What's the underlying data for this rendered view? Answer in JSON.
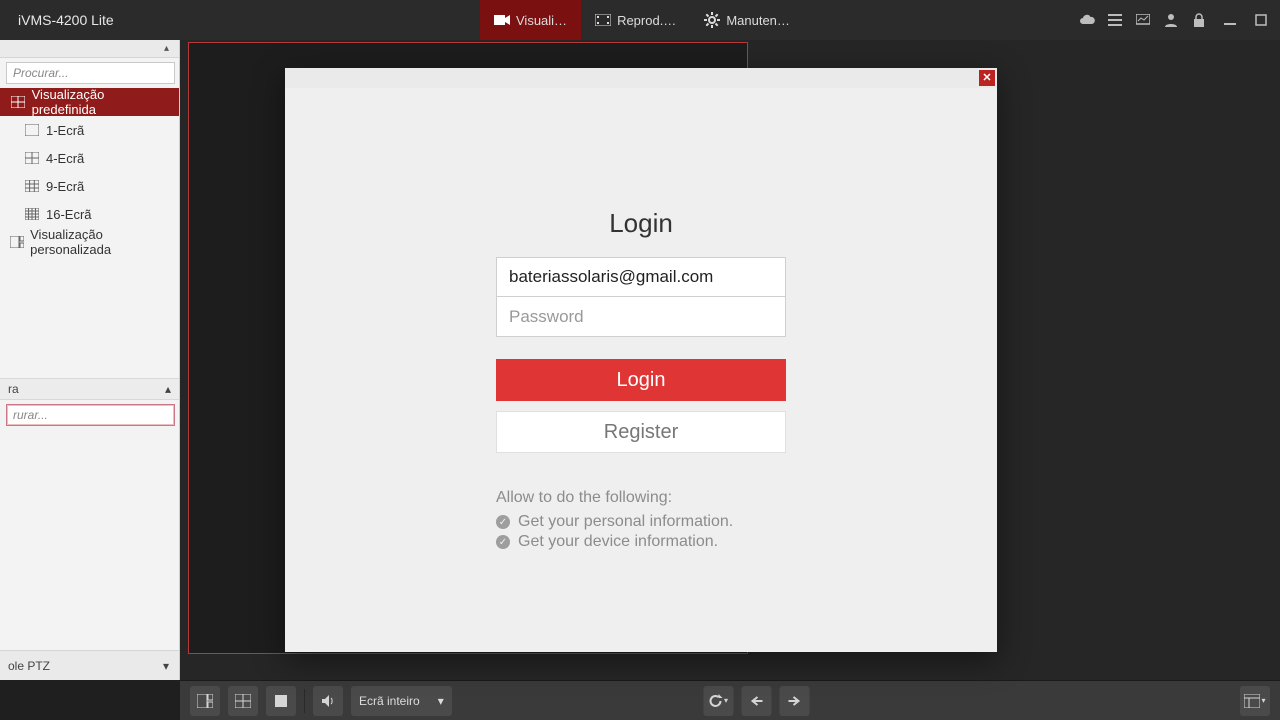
{
  "app": {
    "title": "iVMS-4200 Lite"
  },
  "tabs": [
    {
      "label": "Visuali…",
      "icon": "camera"
    },
    {
      "label": "Reprod.…",
      "icon": "film"
    },
    {
      "label": "Manuten…",
      "icon": "gear"
    }
  ],
  "sidebar": {
    "search_placeholder": "Procurar...",
    "predefined_label": "Visualização predefinida",
    "views": [
      {
        "label": "1-Ecrã"
      },
      {
        "label": "4-Ecrã"
      },
      {
        "label": "9-Ecrã"
      },
      {
        "label": "16-Ecrã"
      }
    ],
    "custom_label": "Visualização personalizada",
    "camera_section_label": "ra",
    "camera_search_placeholder": "rurar...",
    "ptz_label": "ole PTZ"
  },
  "bottom": {
    "screen_mode": "Ecrã inteiro"
  },
  "dialog": {
    "title": "Login",
    "email": "bateriassolaris@gmail.com",
    "password_placeholder": "Password",
    "login_btn": "Login",
    "register_btn": "Register",
    "allow_header": "Allow to do the following:",
    "allow1": "Get your personal information.",
    "allow2": "Get your device information."
  }
}
